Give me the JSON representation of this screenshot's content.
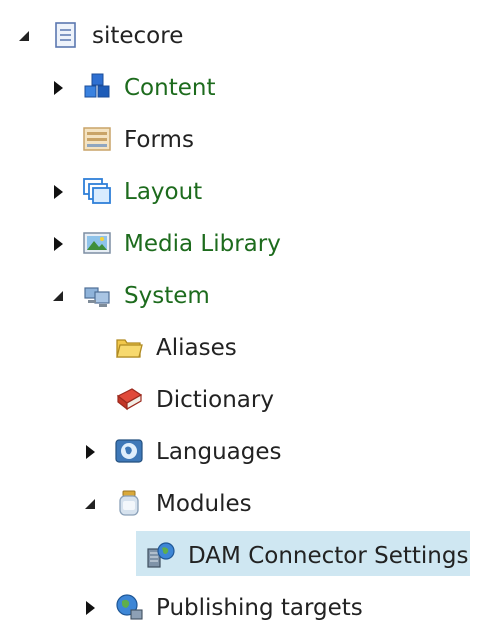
{
  "tree": {
    "root": {
      "label": "sitecore",
      "icon": "document-icon",
      "expanded": true
    },
    "items": [
      {
        "label": "Content",
        "icon": "cubes-icon",
        "expanded": false,
        "has_children": true
      },
      {
        "label": "Forms",
        "icon": "forms-icon",
        "has_children": false
      },
      {
        "label": "Layout",
        "icon": "windows-icon",
        "expanded": false,
        "has_children": true
      },
      {
        "label": "Media Library",
        "icon": "image-icon",
        "expanded": false,
        "has_children": true
      },
      {
        "label": "System",
        "icon": "computers-icon",
        "expanded": true,
        "has_children": true,
        "children": [
          {
            "label": "Aliases",
            "icon": "folder-icon",
            "has_children": false
          },
          {
            "label": "Dictionary",
            "icon": "book-icon",
            "has_children": false
          },
          {
            "label": "Languages",
            "icon": "globe-icon",
            "expanded": false,
            "has_children": true
          },
          {
            "label": "Modules",
            "icon": "jar-icon",
            "expanded": true,
            "has_children": true,
            "children": [
              {
                "label": "DAM Connector Settings",
                "icon": "server-globe-icon",
                "selected": true
              }
            ]
          },
          {
            "label": "Publishing targets",
            "icon": "globe-network-icon",
            "expanded": false,
            "has_children": true
          }
        ]
      }
    ]
  },
  "colors": {
    "green_text": "#1d6b1d",
    "selected_bg": "#cfe7f2",
    "text": "#222222"
  }
}
